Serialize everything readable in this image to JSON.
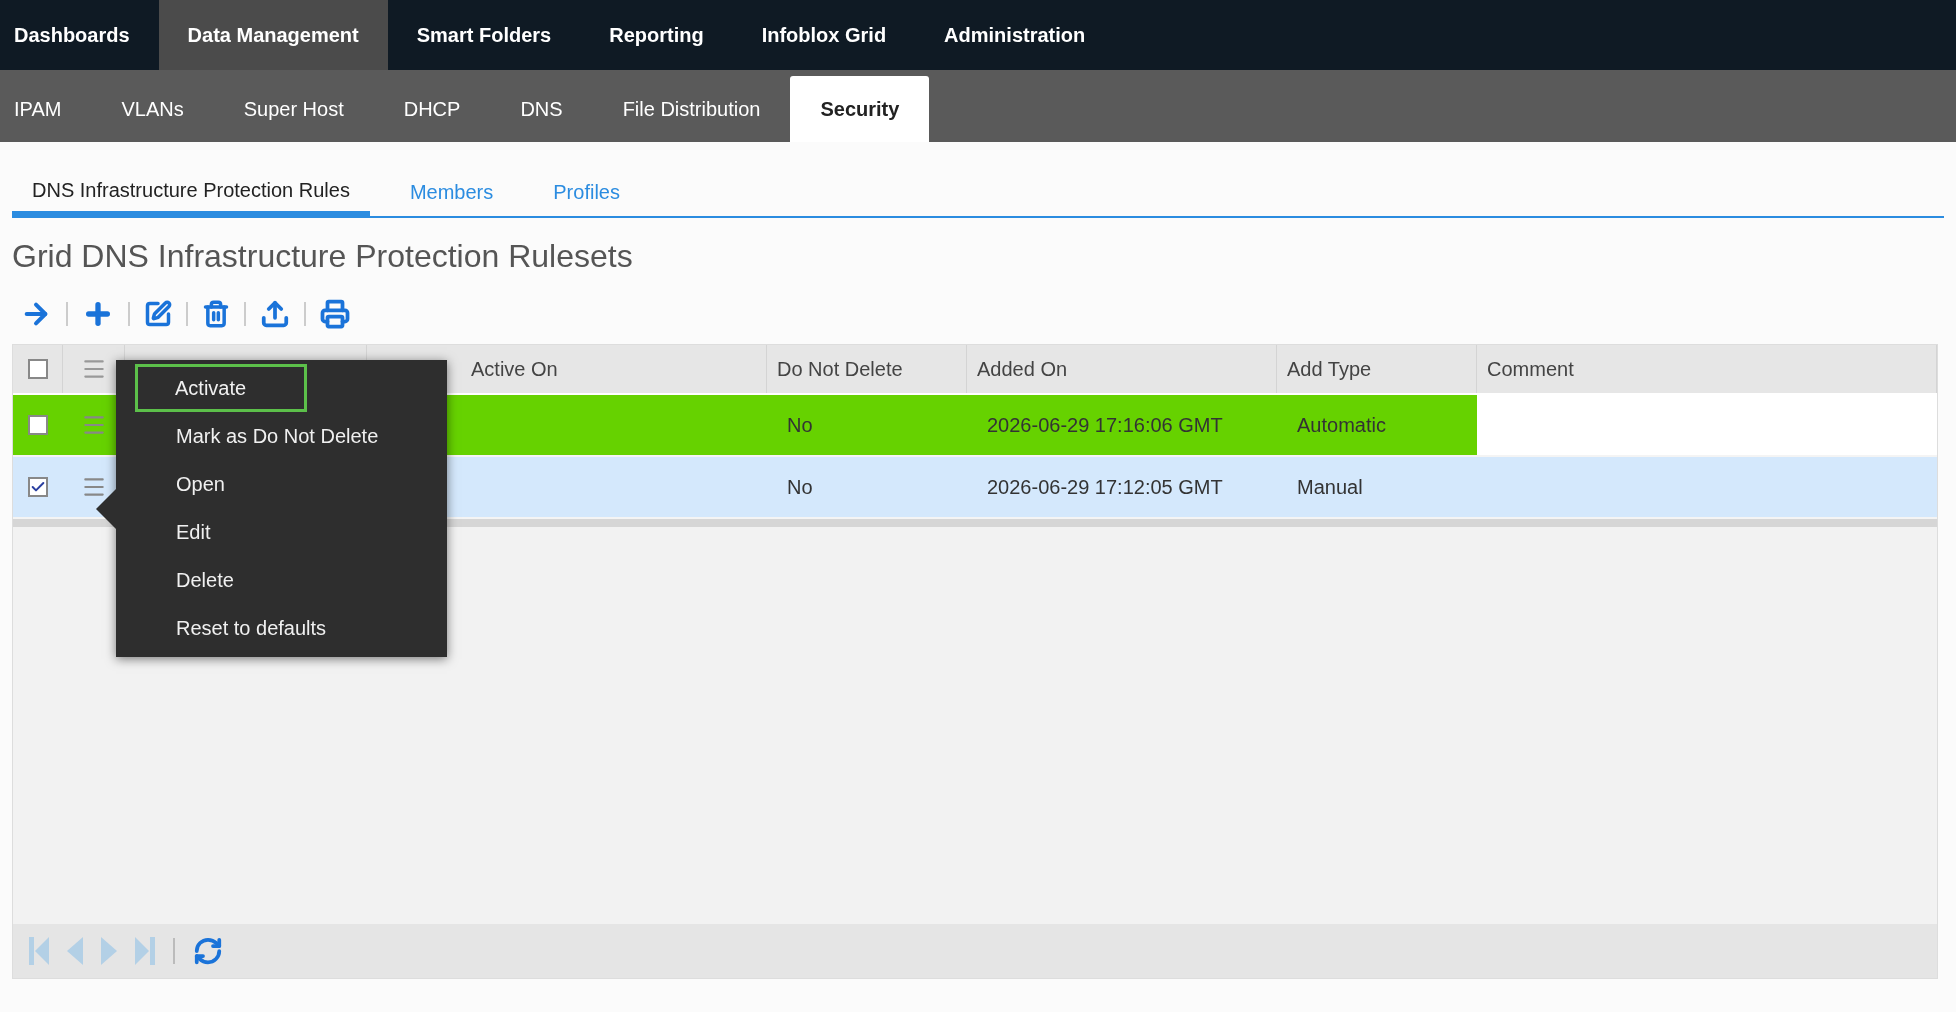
{
  "top_nav": [
    {
      "label": "Dashboards",
      "selected": false
    },
    {
      "label": "Data Management",
      "selected": true
    },
    {
      "label": "Smart Folders",
      "selected": false
    },
    {
      "label": "Reporting",
      "selected": false
    },
    {
      "label": "Infoblox Grid",
      "selected": false
    },
    {
      "label": "Administration",
      "selected": false
    }
  ],
  "sub_nav": [
    {
      "label": "IPAM",
      "selected": false
    },
    {
      "label": "VLANs",
      "selected": false
    },
    {
      "label": "Super Host",
      "selected": false
    },
    {
      "label": "DHCP",
      "selected": false
    },
    {
      "label": "DNS",
      "selected": false
    },
    {
      "label": "File Distribution",
      "selected": false
    },
    {
      "label": "Security",
      "selected": true
    }
  ],
  "section_tabs": [
    {
      "label": "DNS Infrastructure Protection Rules",
      "selected": true
    },
    {
      "label": "Members",
      "selected": false
    },
    {
      "label": "Profiles",
      "selected": false
    }
  ],
  "title": "Grid DNS Infrastructure Protection Rulesets",
  "table": {
    "select_all_checked": false,
    "columns": [
      "Active On",
      "Do Not Delete",
      "Added On",
      "Add Type",
      "Comment"
    ],
    "rows": [
      {
        "checked": false,
        "selected": false,
        "active": true,
        "do_not_delete": "No",
        "added_on": "2026-06-29 17:16:06 GMT",
        "add_type": "Automatic"
      },
      {
        "checked": true,
        "selected": true,
        "active": false,
        "do_not_delete": "No",
        "added_on": "2026-06-29 17:12:05 GMT",
        "add_type": "Manual"
      }
    ]
  },
  "context_menu": {
    "items": [
      {
        "label": "Activate",
        "highlighted": true
      },
      {
        "label": "Mark as Do Not Delete",
        "highlighted": false
      },
      {
        "label": "Open",
        "highlighted": false
      },
      {
        "label": "Edit",
        "highlighted": false
      },
      {
        "label": "Delete",
        "highlighted": false
      },
      {
        "label": "Reset to defaults",
        "highlighted": false
      }
    ]
  },
  "pager": {
    "disabled": true
  }
}
